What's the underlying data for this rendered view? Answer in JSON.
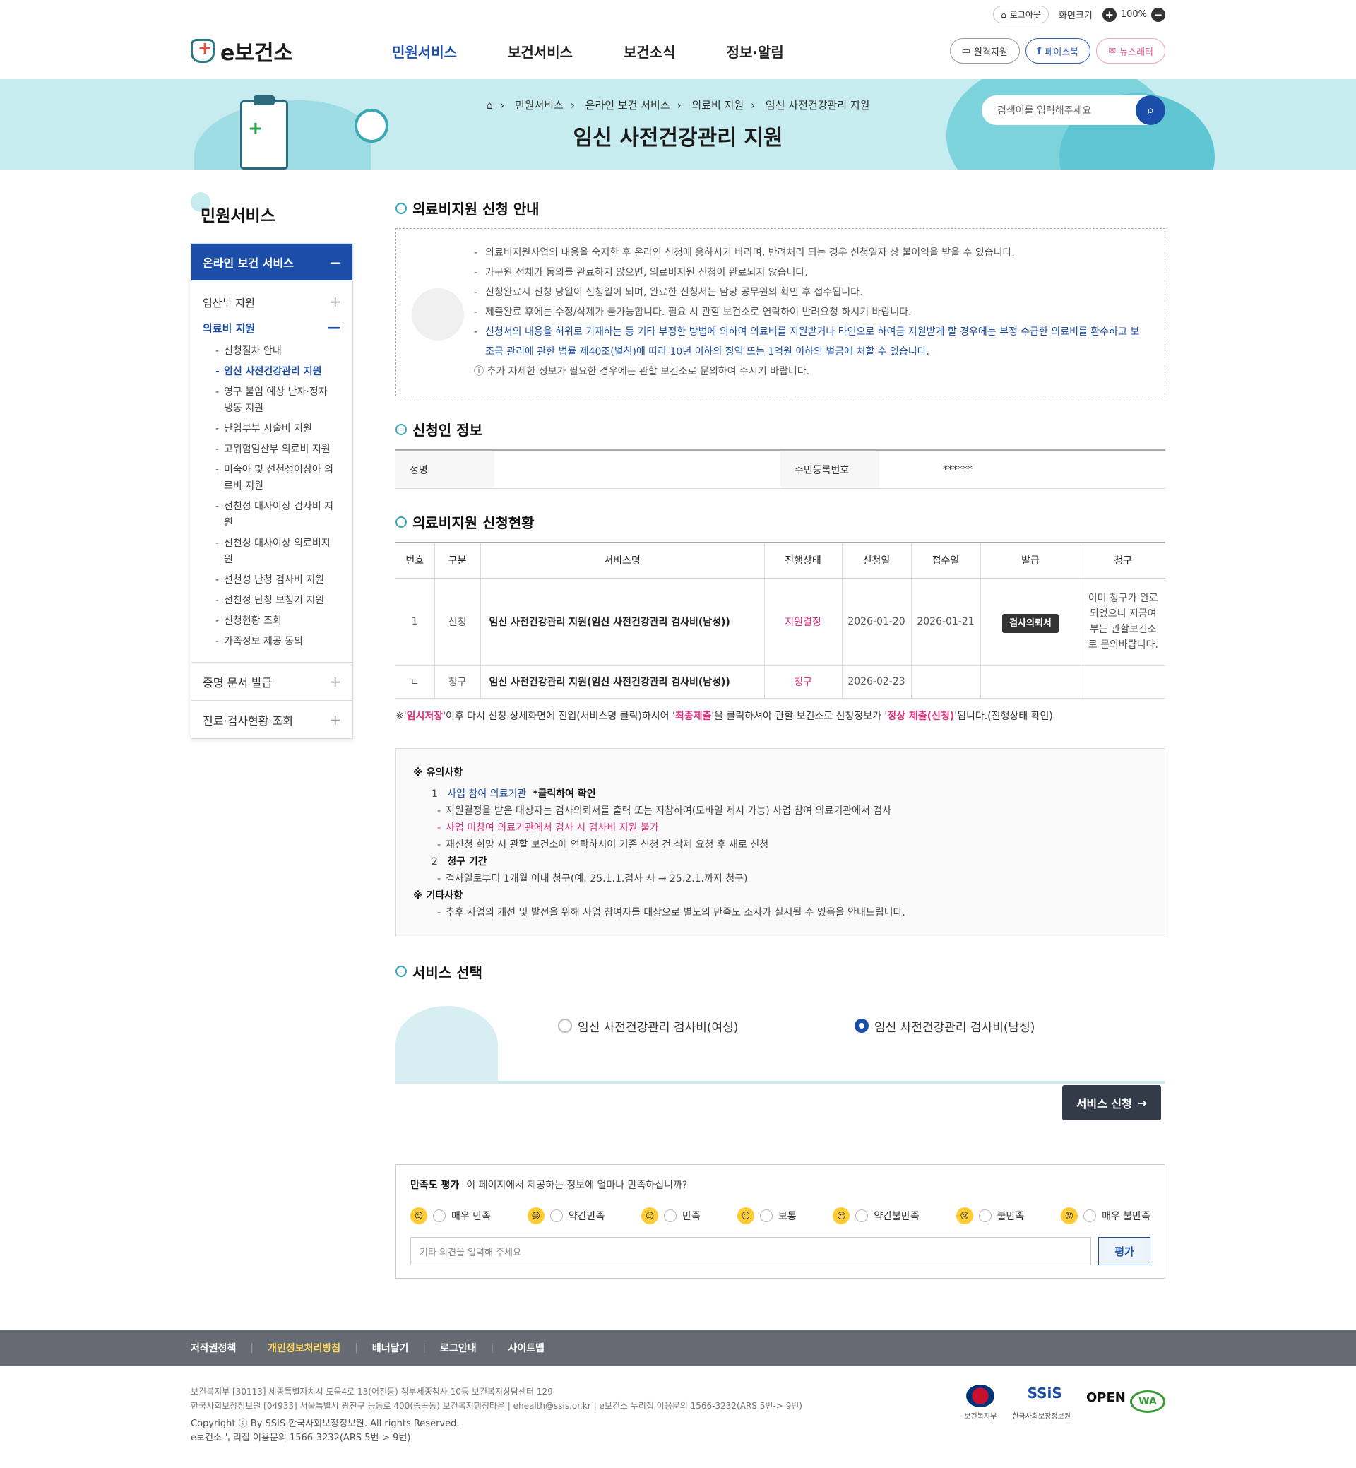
{
  "utility": {
    "logout": "로그아웃",
    "zoom_label": "화면크기",
    "zoom_value": "100%"
  },
  "logo": {
    "text": "e보건소"
  },
  "gnb": [
    "민원서비스",
    "보건서비스",
    "보건소식",
    "정보·알림"
  ],
  "sns": {
    "remote": "원격지원",
    "facebook": "페이스북",
    "newsletter": "뉴스레터"
  },
  "breadcrumb": [
    "민원서비스",
    "온라인 보건 서비스",
    "의료비 지원",
    "임신 사전건강관리 지원"
  ],
  "page_title": "임신 사전건강관리 지원",
  "search": {
    "placeholder": "검색어를 입력해주세요"
  },
  "lnb": {
    "title": "민원서비스",
    "head": "온라인 보건 서비스",
    "items": [
      "임산부 지원",
      "의료비 지원"
    ],
    "subitems": [
      "신청절차 안내",
      "임신 사전건강관리 지원",
      "영구 불임 예상 난자·정자 냉동 지원",
      "난임부부 시술비 지원",
      "고위험임산부 의료비 지원",
      "미숙아 및 선천성이상아 의료비 지원",
      "선천성 대사이상 검사비 지원",
      "선천성 대사이상 의료비지원",
      "선천성 난청 검사비 지원",
      "선천성 난청 보청기 지원",
      "신청현황 조회",
      "가족정보 제공 동의"
    ],
    "sections": [
      "증명 문서 발급",
      "진료·검사현황 조회"
    ]
  },
  "notice": {
    "title": "의료비지원 신청 안내",
    "lines": [
      "의료비지원사업의 내용을 숙지한 후 온라인 신청에 응하시기 바라며, 반려처리 되는 경우 신청일자 상 불이익을 받을 수 있습니다.",
      "가구원 전체가 동의를 완료하지 않으면, 의료비지원 신청이 완료되지 않습니다.",
      "신청완료시 신청 당일이 신청일이 되며, 완료한 신청서는 담당 공무원의 확인 후 접수됩니다.",
      "제출완료 후에는 수정/삭제가 불가능합니다. 필요 시 관할 보건소로 연락하여 반려요청 하시기 바랍니다."
    ],
    "warning": "신청서의 내용을 허위로 기재하는 등 기타 부정한 방법에 의하여 의료비를 지원받거나 타인으로 하여금 지원받게 할 경우에는 부정 수급한 의료비를 환수하고 보조금 관리에 관한 법률 제40조(벌칙)에 따라 10년 이하의 징역 또는 1억원 이하의 벌금에 처할 수 있습니다.",
    "extra": "추가 자세한 정보가 필요한 경우에는 관할 보건소로 문의하여 주시기 바랍니다."
  },
  "applicant": {
    "title": "신청인 정보",
    "name_label": "성명",
    "id_label": "주민등록번호",
    "id_value": "******"
  },
  "status": {
    "title": "의료비지원 신청현황",
    "headers": [
      "번호",
      "구분",
      "서비스명",
      "진행상태",
      "신청일",
      "접수일",
      "발급",
      "청구"
    ],
    "row1": {
      "no": "1",
      "type": "신청",
      "service": "임신 사전건강관리 지원(임신 사전건강관리 검사비(남성))",
      "state": "지원결정",
      "apply": "2026-01-20",
      "receipt": "2026-01-21",
      "issue": "검사의뢰서",
      "claim": "이미 청구가 완료되었으니 지금여부는 관할보건소로 문의바랍니다."
    },
    "row2": {
      "no": "ㄴ",
      "type": "청구",
      "service": "임신 사전건강관리 지원(임신 사전건강관리 검사비(남성))",
      "state": "청구",
      "apply": "2026-02-23"
    },
    "note_a": "※'",
    "note_b": "임시저장",
    "note_c": "'이후 다시 신청 상세화면에 진입(서비스명 클릭)하시어 '",
    "note_d": "최종제출",
    "note_e": "'을 클릭하셔야 관할 보건소로 신청정보가 '",
    "note_f": "정상 제출(신청)",
    "note_g": "'됩니다.(진행상태 확인)"
  },
  "caution": {
    "title": "※ 유의사항",
    "i1": "사업 참여 의료기관",
    "i1b": "*클릭하여 확인",
    "s1": "지원결정을 받은 대상자는 검사의뢰서를 출력 또는 지참하여(모바일 제시 가능) 사업 참여 의료기관에서 검사",
    "s2": "사업 미참여 의료기관에서 검사 시 검사비 지원 불가",
    "s3": "재신청 희망 시 관할 보건소에 연락하시어 기존 신청 건 삭제 요청 후 새로 신청",
    "i2": "청구 기간",
    "s4": "검사일로부터 1개월 이내 청구(예: 25.1.1.검사 시 → 25.2.1.까지 청구)",
    "etc_title": "※ 기타사항",
    "s5": "추후 사업의 개선 및 발전을 위해 사업 참여자를 대상으로 별도의 만족도 조사가 실시될 수 있음을 안내드립니다."
  },
  "service_select": {
    "title": "서비스 선택",
    "opt1": "임신 사전건강관리 검사비(여성)",
    "opt2": "임신 사전건강관리 검사비(남성)",
    "apply": "서비스 신청"
  },
  "survey": {
    "title": "만족도 평가",
    "question": "이 페이지에서 제공하는 정보에 얼마나 만족하십니까?",
    "options": [
      "매우 만족",
      "약간만족",
      "만족",
      "보통",
      "약간불만족",
      "불만족",
      "매우 불만족"
    ],
    "placeholder": "기타 의견을 입력해 주세요",
    "submit": "평가"
  },
  "footer": {
    "links": [
      "저작권정책",
      "개인정보처리방침",
      "배너달기",
      "로그안내",
      "사이트맵"
    ],
    "addr1": "보건복지부   [30113] 세종특별자치시 도움4로 13(어진동) 정부세종청사 10동 보건복지상담센터 129",
    "addr2": "한국사회보장정보원   [04933] 서울특별시 광진구 능동로 400(중곡동) 보건복지행정타운  |  ehealth@ssis.or.kr  |  e보건소 누리집 이용문의 1566-3232(ARS 5번-> 9번)",
    "copy": "Copyright ⓒ By SSIS 한국사회보장정보원. All rights Reserved.",
    "contact": "e보건소 누리집 이용문의 1566-3232(ARS 5번-> 9번)",
    "logos": [
      "보건복지부",
      "한국사회보장정보원",
      "OPEN",
      "WA"
    ]
  }
}
